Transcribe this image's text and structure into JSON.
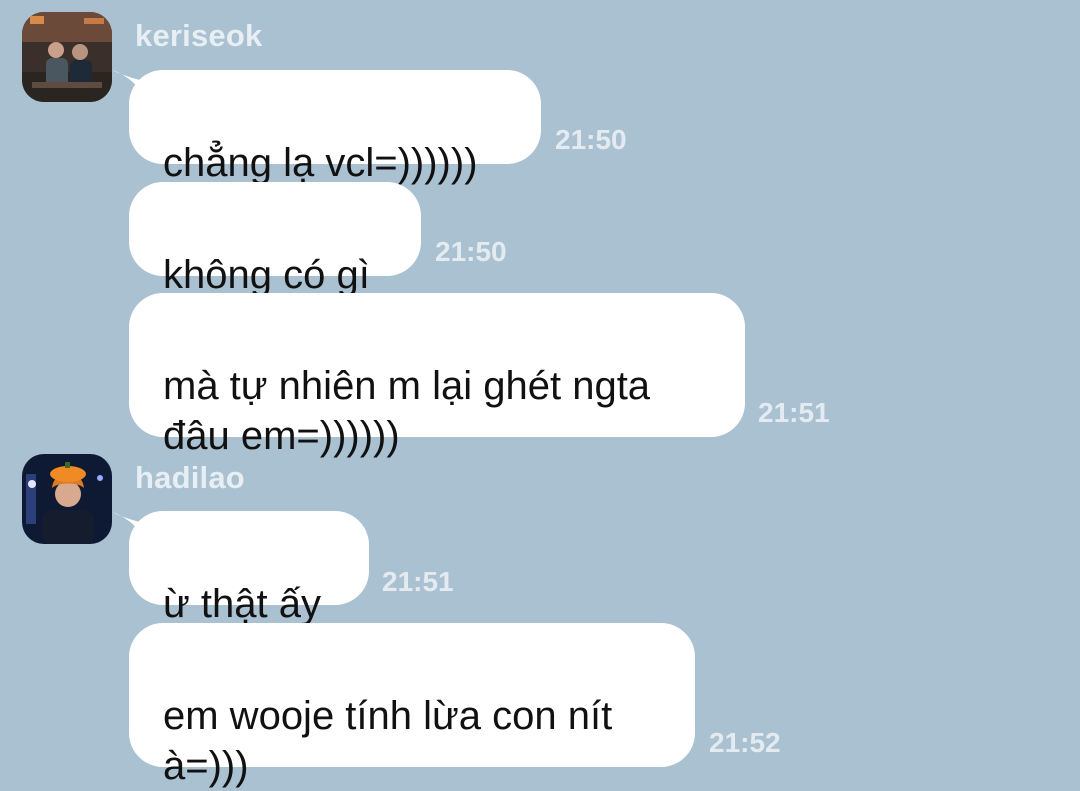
{
  "colors": {
    "background": "#aac1d1",
    "bubble": "#ffffff",
    "username": "#e7eef4",
    "timestamp": "#e3ebf1"
  },
  "groups": [
    {
      "username": "keriseok",
      "avatar": "photo-avatar-two-people",
      "messages": [
        {
          "text": "chẳng lạ vcl=))))))",
          "time": "21:50"
        },
        {
          "text": "không có gì",
          "time": "21:50"
        },
        {
          "text": "mà tự nhiên m lại ghét ngta\nđâu em=))))))",
          "time": "21:51"
        }
      ]
    },
    {
      "username": "hadilao",
      "avatar": "photo-avatar-person-orange-hat",
      "messages": [
        {
          "text": "ừ thật ấy",
          "time": "21:51"
        },
        {
          "text": "em wooje tính lừa con nít\nà=)))",
          "time": "21:52"
        }
      ]
    }
  ]
}
